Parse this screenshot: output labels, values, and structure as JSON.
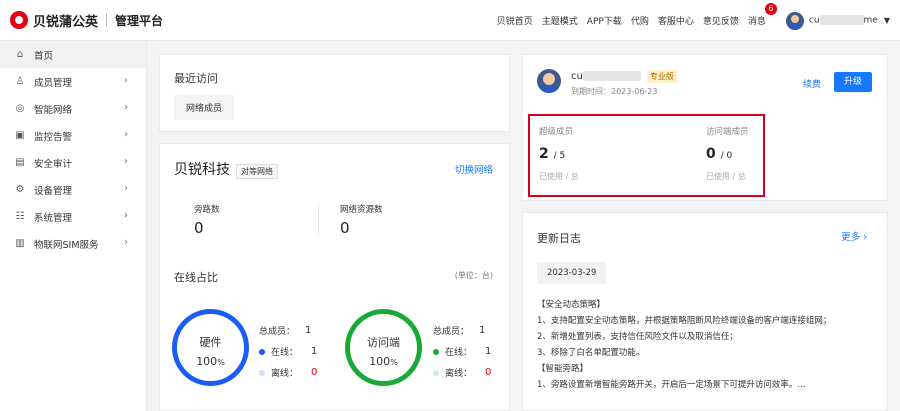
{
  "brand": {
    "name": "贝锐蒲公英",
    "sub": "管理平台"
  },
  "topnav": {
    "links": [
      "贝锐首页",
      "主题模式",
      "APP下载",
      "代购",
      "客服中心",
      "意见反馈"
    ],
    "messages": "消息",
    "msg_badge": "6",
    "user_prefix": "cu",
    "user_suffix": "me"
  },
  "sidebar": {
    "items": [
      {
        "label": "首页",
        "icon": "home-icon",
        "glyph": "⌂"
      },
      {
        "label": "成员管理",
        "icon": "user-icon",
        "glyph": "♙"
      },
      {
        "label": "智能网络",
        "icon": "network-icon",
        "glyph": "◎"
      },
      {
        "label": "监控告警",
        "icon": "monitor-icon",
        "glyph": "▣"
      },
      {
        "label": "安全审计",
        "icon": "audit-icon",
        "glyph": "▤"
      },
      {
        "label": "设备管理",
        "icon": "device-icon",
        "glyph": "⚙"
      },
      {
        "label": "系统管理",
        "icon": "settings-icon",
        "glyph": "☷"
      },
      {
        "label": "物联网SIM服务",
        "icon": "sim-icon",
        "glyph": "▥"
      }
    ]
  },
  "recent": {
    "title": "最近访问",
    "item": "网络成员"
  },
  "org": {
    "name": "贝锐科技",
    "mode": "对等网络",
    "switch": "切换网络",
    "bypass_label": "旁路数",
    "bypass_value": "0",
    "resource_label": "网络资源数",
    "resource_value": "0",
    "online_title": "在线占比",
    "unit": "(单位：台)",
    "hardware": {
      "label": "硬件",
      "pct": "100",
      "total_label": "总成员：",
      "total": "1",
      "online_label": "在线：",
      "online": "1",
      "offline_label": "离线：",
      "offline": "0"
    },
    "visitor": {
      "label": "访问端",
      "pct": "100",
      "total_label": "总成员：",
      "total": "1",
      "online_label": "在线：",
      "online": "1",
      "offline_label": "离线：",
      "offline": "0"
    }
  },
  "account": {
    "name_prefix": "cu",
    "edition": "专业版",
    "expire": "到期时间：2023-06-23",
    "renew": "续费",
    "upgrade": "升级",
    "super_label": "超级成员",
    "super_used": "2",
    "super_total": "/ 5",
    "visitor_label": "访问端成员",
    "visitor_used": "0",
    "visitor_total": "/ 0",
    "used_hint": "已使用 / 总"
  },
  "changelog": {
    "title": "更新日志",
    "more": "更多",
    "date": "2023-03-29",
    "lines": [
      "【安全动态策略】",
      "1、支持配置安全动态策略，并根据策略阻断风险终端设备的客户端连接组网；",
      "2、新增处置列表，支持信任风险文件以及取消信任；",
      "3、移除了白名单配置功能。",
      "【智能旁路】",
      "1、旁路设置新增智能旁路开关，开启后一定场景下可提升访问效率。..."
    ]
  },
  "colors": {
    "accent": "#1677ff",
    "brand": "#e60012",
    "hardware_ring": "#1a5cf5",
    "visitor_ring": "#1aa836",
    "highlight": "#d9001b"
  }
}
